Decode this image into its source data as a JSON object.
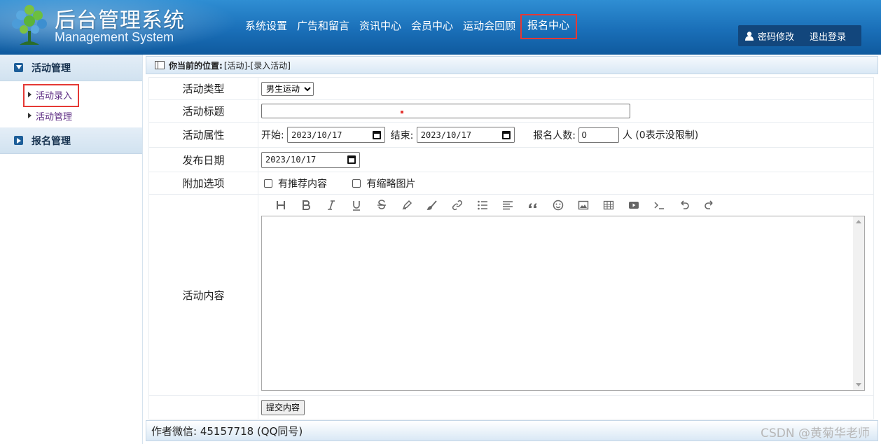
{
  "header": {
    "title": "后台管理系统",
    "subtitle": "Management System",
    "nav": [
      "系统设置",
      "广告和留言",
      "资讯中心",
      "会员中心",
      "运动会回顾",
      "报名中心"
    ],
    "user_links": {
      "change_password": "密码修改",
      "logout": "退出登录"
    }
  },
  "sidebar": {
    "sections": [
      {
        "label": "活动管理",
        "items": [
          "活动录入",
          "活动管理"
        ]
      },
      {
        "label": "报名管理",
        "items": []
      }
    ]
  },
  "breadcrumb": {
    "label": "你当前的位置:",
    "path": "[活动]-[录入活动]"
  },
  "form": {
    "type_label": "活动类型",
    "type_value": "男生运动",
    "title_label": "活动标题",
    "title_value": "",
    "attr_label": "活动属性",
    "start_label": "开始:",
    "start_value": "2023/10/17",
    "end_label": "结束:",
    "end_value": "2023/10/17",
    "signup_label": "报名人数:",
    "signup_value": "0",
    "signup_suffix": "人 (0表示没限制)",
    "date_label": "发布日期",
    "date_value": "2023/10/17",
    "options_label": "附加选项",
    "opt_recommend": "有推荐内容",
    "opt_thumb": "有缩略图片",
    "content_label": "活动内容",
    "submit_label": "提交内容"
  },
  "editor_toolbar": [
    "heading-icon",
    "bold-icon",
    "italic-icon",
    "underline-icon",
    "strikethrough-icon",
    "highlighter-icon",
    "brush-icon",
    "link-icon",
    "list-icon",
    "align-icon",
    "quote-icon",
    "emoji-icon",
    "image-icon",
    "table-icon",
    "video-icon",
    "code-icon",
    "undo-icon",
    "redo-icon"
  ],
  "footer": {
    "text": "作者微信: 45157718 (QQ同号)"
  },
  "watermark": "CSDN @黄菊华老师",
  "colors": {
    "header": "#1a6fb8",
    "highlight": "#e53935",
    "sidebar_section": "#d1e2f0"
  }
}
